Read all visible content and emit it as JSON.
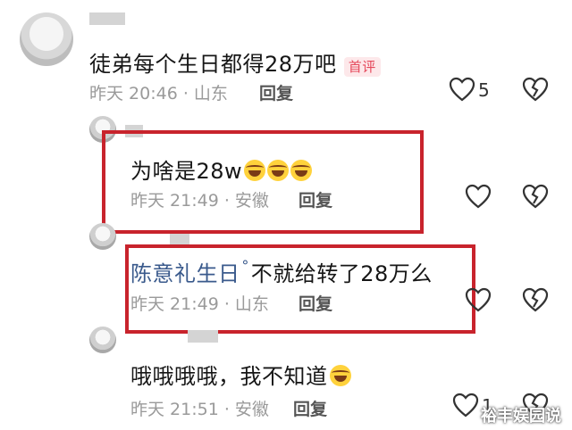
{
  "comments": [
    {
      "text": "徒弟每个生日都得28万吧",
      "badge": "首评",
      "meta": "昨天 20:46 · 山东",
      "reply_label": "回复",
      "like_count": "5"
    },
    {
      "text": "为啥是28w",
      "meta": "昨天 21:49 · 安徽",
      "reply_label": "回复"
    },
    {
      "mention": "陈意礼生日",
      "text": "不就给转了28万么",
      "meta": "昨天 21:49 · 山东",
      "reply_label": "回复"
    },
    {
      "text": "哦哦哦哦，我不知道",
      "meta": "昨天 21:51 · 安徽",
      "reply_label": "回复",
      "like_count": "1"
    }
  ],
  "watermark": "裕丰娱园说",
  "colors": {
    "highlight_box": "#c8232c",
    "mention": "#3a5a8c",
    "badge": "#e5485b"
  },
  "icons": [
    "heart-icon",
    "broken-heart-icon",
    "laughing-emoji-icon",
    "search-link-icon"
  ]
}
